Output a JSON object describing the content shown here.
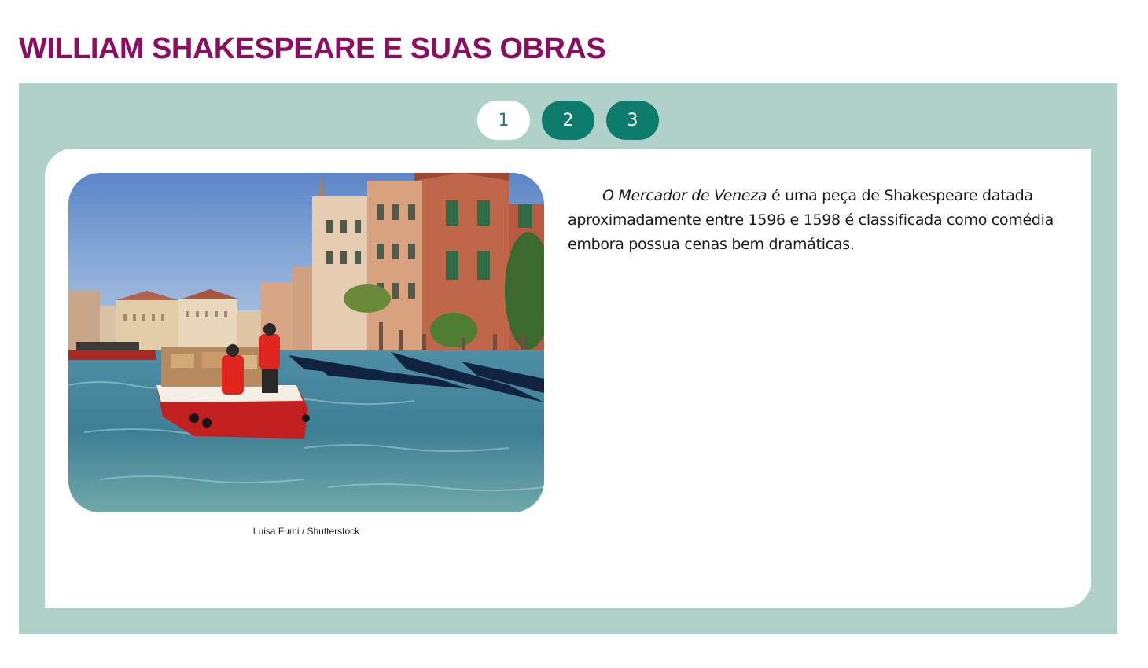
{
  "page": {
    "title": "WILLIAM SHAKESPEARE E SUAS OBRAS"
  },
  "pager": {
    "pages": [
      "1",
      "2",
      "3"
    ],
    "active_index": 0
  },
  "content": {
    "image_alt": "Barco de entregas vermelho navegando no Grande Canal de Veneza, com gôndolas e edifícios históricos",
    "image_credit": "Luisa Fumi / Shutterstock",
    "text_title_italic": "O Mercador de Veneza",
    "text_rest": " é uma peça de Shakespeare datada aproximadamente entre 1596 e 1598 é classificada como comédia embora possua cenas bem dramáticas."
  },
  "colors": {
    "title": "#8a0f62",
    "panel_bg": "#b0d1c9",
    "pager_active_bg": "#ffffff",
    "pager_inactive_bg": "#0e7c6c"
  }
}
